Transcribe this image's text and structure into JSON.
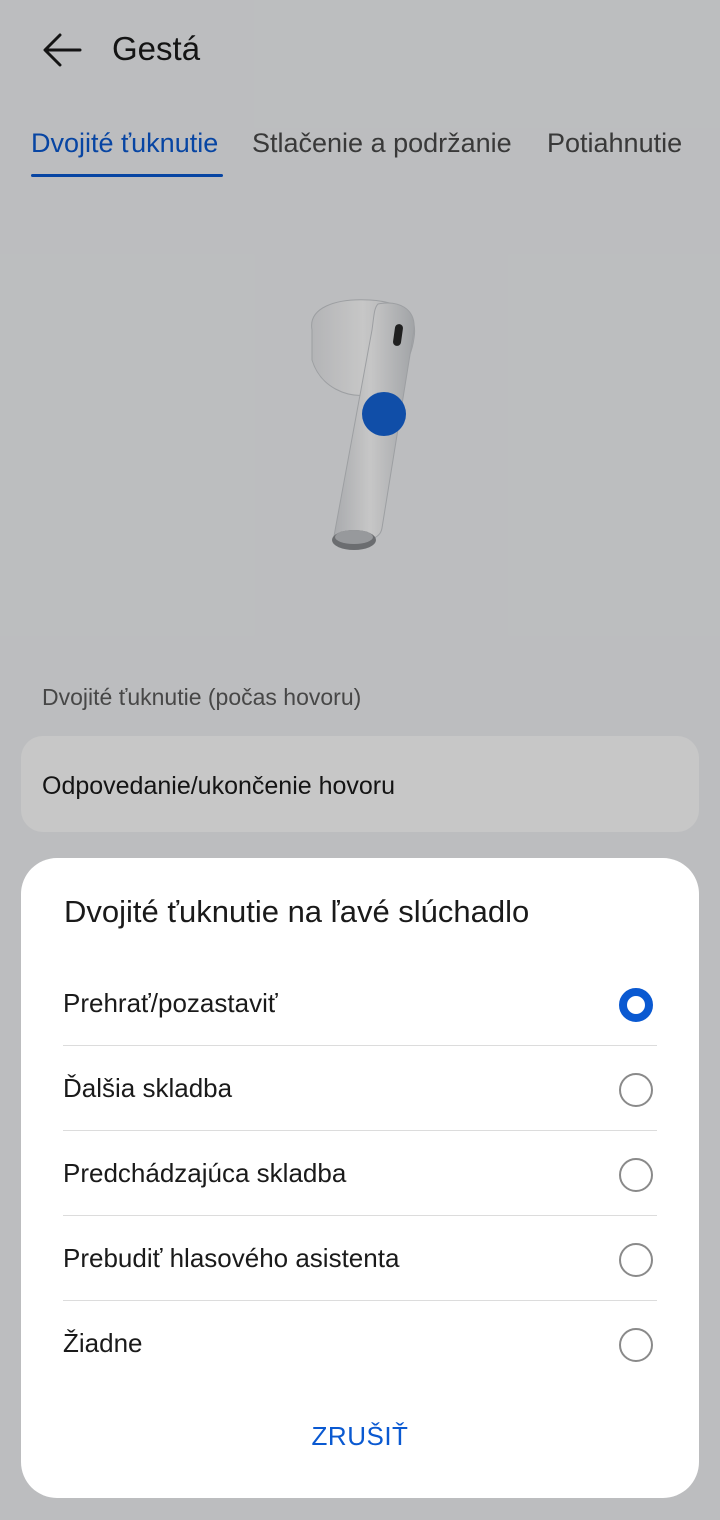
{
  "header": {
    "title": "Gestá",
    "back_icon": "arrow-left-icon"
  },
  "tabs": [
    {
      "label": "Dvojité ťuknutie",
      "active": true
    },
    {
      "label": "Stlačenie a podržanie",
      "active": false
    },
    {
      "label": "Potiahnutie",
      "active": false
    }
  ],
  "illustration": {
    "icon": "earbud-icon",
    "tap_point_color": "#1565d8"
  },
  "section": {
    "header": "Dvojité ťuknutie (počas hovoru)",
    "value": "Odpovedanie/ukončenie hovoru"
  },
  "dialog": {
    "title": "Dvojité ťuknutie na ľavé slúchadlo",
    "options": [
      {
        "label": "Prehrať/pozastaviť",
        "selected": true
      },
      {
        "label": "Ďalšia skladba",
        "selected": false
      },
      {
        "label": "Predchádzajúca skladba",
        "selected": false
      },
      {
        "label": "Prebudiť hlasového asistenta",
        "selected": false
      },
      {
        "label": "Žiadne",
        "selected": false
      }
    ],
    "cancel_label": "ZRUŠIŤ"
  },
  "colors": {
    "accent": "#0a59d1",
    "background": "#f1f3f5",
    "card": "#ffffff"
  }
}
